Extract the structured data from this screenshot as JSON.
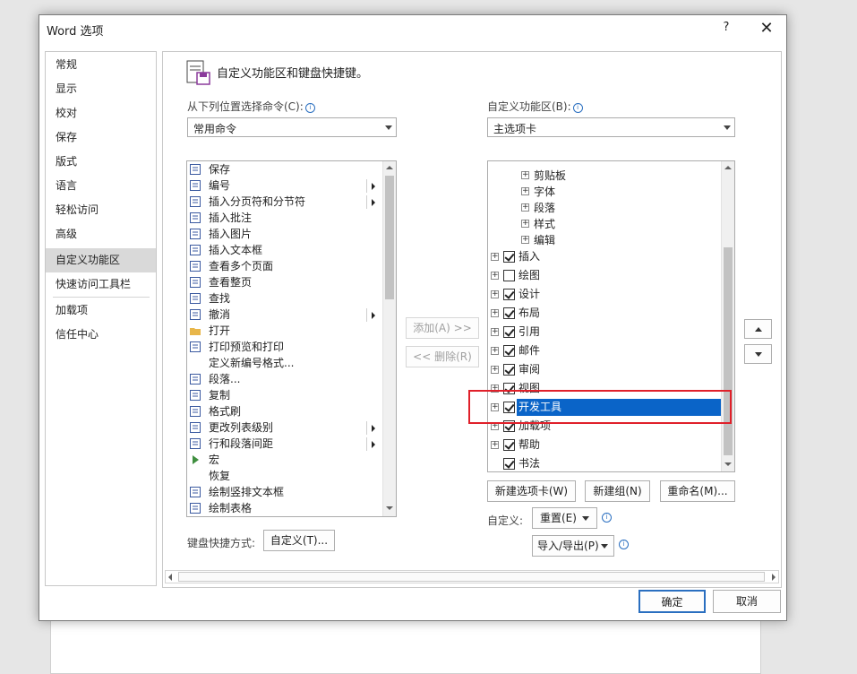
{
  "dialog": {
    "title": "Word 选项",
    "help": "?",
    "close": "✕",
    "ok": "确定",
    "cancel": "取消"
  },
  "nav": [
    "常规",
    "显示",
    "校对",
    "保存",
    "版式",
    "语言",
    "轻松访问",
    "高级",
    "自定义功能区",
    "快速访问工具栏",
    "加载项",
    "信任中心"
  ],
  "nav_selected": "自定义功能区",
  "header": {
    "title": "自定义功能区和键盘快捷键。"
  },
  "left_panel": {
    "label": "从下列位置选择命令(C):",
    "combo_value": "常用命令",
    "commands": [
      "保存",
      "编号",
      "插入分页符和分节符",
      "插入批注",
      "插入图片",
      "插入文本框",
      "查看多个页面",
      "查看整页",
      "查找",
      "撤消",
      "打开",
      "打印预览和打印",
      "定义新编号格式...",
      "段落...",
      "复制",
      "格式刷",
      "更改列表级别",
      "行和段落间距",
      "宏",
      "恢复",
      "绘制竖排文本框",
      "绘制表格"
    ],
    "submenu_items": [
      "编号",
      "插入分页符和分节符",
      "撤消",
      "更改列表级别",
      "行和段落间距"
    ]
  },
  "middle": {
    "add": "添加(A) >>",
    "remove": "<< 删除(R)"
  },
  "right_panel": {
    "label": "自定义功能区(B):",
    "combo_value": "主选项卡",
    "groups": [
      "剪贴板",
      "字体",
      "段落",
      "样式",
      "编辑"
    ],
    "tabs": [
      {
        "label": "插入",
        "checked": true
      },
      {
        "label": "绘图",
        "checked": false
      },
      {
        "label": "设计",
        "checked": true
      },
      {
        "label": "布局",
        "checked": true
      },
      {
        "label": "引用",
        "checked": true
      },
      {
        "label": "邮件",
        "checked": true
      },
      {
        "label": "审阅",
        "checked": true
      },
      {
        "label": "视图",
        "checked": true
      },
      {
        "label": "开发工具",
        "checked": true,
        "selected": true
      },
      {
        "label": "加载项",
        "checked": true
      },
      {
        "label": "帮助",
        "checked": true
      },
      {
        "label": "书法",
        "checked": true
      }
    ],
    "new_tab": "新建选项卡(W)",
    "new_group": "新建组(N)",
    "rename": "重命名(M)...",
    "customize_label": "自定义:",
    "reset": "重置(E)",
    "import_export": "导入/导出(P)"
  },
  "keyboard": {
    "label": "键盘快捷方式:",
    "button": "自定义(T)..."
  },
  "colors": {
    "selection": "#0a64c8",
    "highlight_box": "#e0202a"
  }
}
